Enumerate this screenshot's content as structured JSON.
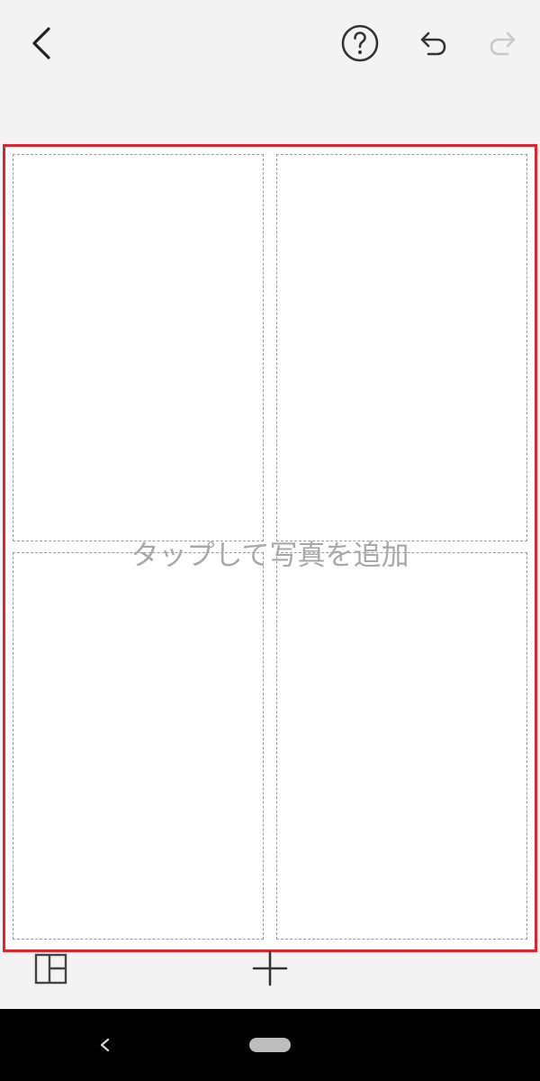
{
  "toolbar": {
    "back_icon": "chevron-left-icon",
    "help_icon": "question-circle-icon",
    "undo_icon": "undo-arrow-icon",
    "redo_icon": "redo-arrow-icon",
    "redo_enabled": false
  },
  "canvas": {
    "hint": "タップして写真を追加",
    "cells": 4,
    "border_color": "#e0242f"
  },
  "bottom_toolbar": {
    "layout_icon": "layout-grid-icon",
    "add_icon": "plus-icon"
  },
  "system_nav": {
    "back_icon": "nav-back-icon",
    "home_icon": "nav-home-pill"
  }
}
